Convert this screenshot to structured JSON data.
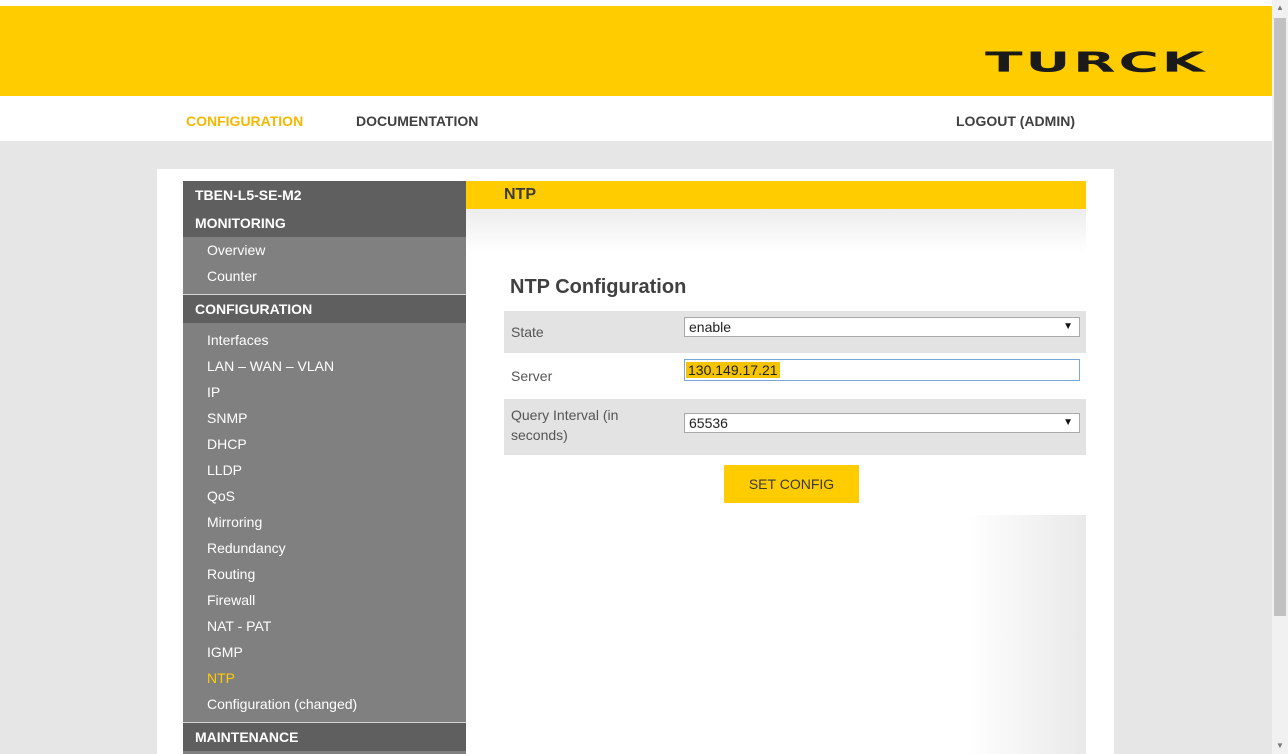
{
  "brand": {
    "logo_text": "TURCK"
  },
  "nav": {
    "configuration": "CONFIGURATION",
    "documentation": "DOCUMENTATION",
    "logout": "LOGOUT (ADMIN)"
  },
  "sidebar": {
    "device": "TBEN-L5-SE-M2",
    "monitoring": {
      "heading": "MONITORING",
      "items": [
        "Overview",
        "Counter"
      ]
    },
    "configuration": {
      "heading": "CONFIGURATION",
      "items": [
        "Interfaces",
        "LAN – WAN – VLAN",
        "IP",
        "SNMP",
        "DHCP",
        "LLDP",
        "QoS",
        "Mirroring",
        "Redundancy",
        "Routing",
        "Firewall",
        "NAT - PAT",
        "IGMP",
        "NTP",
        "Configuration (changed)"
      ]
    },
    "maintenance": {
      "heading": "MAINTENANCE"
    }
  },
  "content": {
    "header": "NTP",
    "form_title": "NTP Configuration",
    "state_label": "State",
    "state_value": "enable",
    "server_label": "Server",
    "server_value": "130.149.17.21",
    "interval_label_line1": "Query Interval (in",
    "interval_label_line2": "seconds)",
    "interval_value": "65536",
    "submit_label": "SET CONFIG"
  },
  "colors": {
    "brand_yellow": "#ffcc00",
    "sidebar_gray": "#808080",
    "sidebar_head": "#5f5f5f"
  }
}
